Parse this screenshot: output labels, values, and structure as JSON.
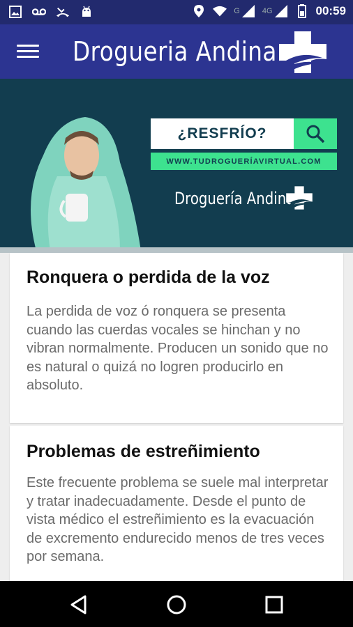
{
  "status_bar": {
    "time": "00:59",
    "network_g": "G",
    "network_4g": "4G",
    "left_icons": [
      "image-icon",
      "voicemail-icon",
      "missed-call-icon",
      "android-icon"
    ],
    "right_icons": [
      "location-icon",
      "wifi-icon",
      "signal-icon",
      "signal-icon",
      "battery-icon"
    ]
  },
  "app_bar": {
    "title": "Drogueria Andina",
    "menu_icon": "hamburger-menu-icon",
    "logo": "cross-logo-icon"
  },
  "banner": {
    "search_text": "¿RESFRÍO?",
    "url": "WWW.TUDROGUERÍAVIRTUAL.COM",
    "brand": "Droguería Andina",
    "colors": {
      "background": "#123d4f",
      "accent": "#3de28f"
    }
  },
  "articles": [
    {
      "title": "Ronquera o perdida de la voz",
      "body": "La perdida de voz ó ronquera se presenta cuando las cuerdas vocales se hinchan y no vibran normalmente. Producen un sonido que no es natural o quizá no logren producirlo en absoluto."
    },
    {
      "title": "Problemas de estreñimiento",
      "body": "Este frecuente problema se suele mal interpretar y tratar inadecuadamente. Desde el punto de vista médico el estreñimiento es la evacuación de excremento endurecido menos de tres veces por semana."
    }
  ],
  "nav_bar": {
    "icons": [
      "back-icon",
      "home-icon",
      "recents-icon"
    ]
  }
}
